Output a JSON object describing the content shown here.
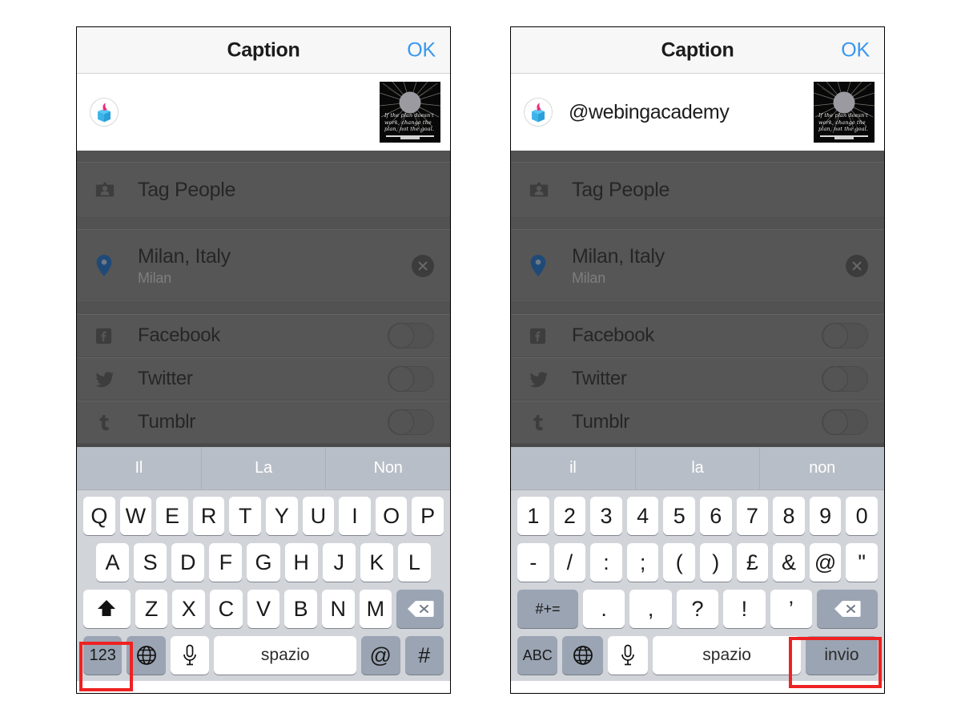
{
  "app": {
    "navbar": {
      "title": "Caption",
      "confirm_label": "OK"
    }
  },
  "left_panel": {
    "caption_value": "",
    "caption_placeholder": "",
    "avatar_icon": "book-avatar-icon",
    "thumbnail": {
      "icon": "post-thumbnail",
      "quote_line1": "If the plan doesn't",
      "quote_line2": "work, change the",
      "quote_line3": "plan, not the goal."
    },
    "options": [
      {
        "label": "Tag People",
        "icon": "tag-people-icon",
        "type": "nav"
      },
      {
        "label": "Milan, Italy",
        "sublabel": "Milan",
        "icon": "location-pin-icon",
        "type": "location",
        "clear_icon": "clear-circle-icon"
      },
      {
        "label": "Facebook",
        "icon": "facebook-icon",
        "type": "toggle",
        "state": "off"
      },
      {
        "label": "Twitter",
        "icon": "twitter-icon",
        "type": "toggle",
        "state": "off"
      },
      {
        "label": "Tumblr",
        "icon": "tumblr-icon",
        "type": "toggle",
        "state": "off"
      }
    ],
    "keyboard": {
      "layout": "letters",
      "suggestions": [
        "Il",
        "La",
        "Non"
      ],
      "row1": [
        "Q",
        "W",
        "E",
        "R",
        "T",
        "Y",
        "U",
        "I",
        "O",
        "P"
      ],
      "row2": [
        "A",
        "S",
        "D",
        "F",
        "G",
        "H",
        "J",
        "K",
        "L"
      ],
      "row3": [
        "Z",
        "X",
        "C",
        "V",
        "B",
        "N",
        "M"
      ],
      "shift_icon": "shift-up-arrow-icon",
      "delete_icon": "backspace-icon",
      "mode_key": "123",
      "globe_icon": "globe-icon",
      "mic_icon": "microphone-icon",
      "space_label": "spazio",
      "at_key": "@",
      "hash_key": "#"
    },
    "highlight": {
      "target": "123",
      "color": "#ee2222"
    }
  },
  "right_panel": {
    "caption_value": "@webingacademy",
    "avatar_icon": "book-avatar-icon",
    "thumbnail": {
      "icon": "post-thumbnail",
      "quote_line1": "If the plan doesn't",
      "quote_line2": "work, change the",
      "quote_line3": "plan, not the goal."
    },
    "options": [
      {
        "label": "Tag People",
        "icon": "tag-people-icon",
        "type": "nav"
      },
      {
        "label": "Milan, Italy",
        "sublabel": "Milan",
        "icon": "location-pin-icon",
        "type": "location",
        "clear_icon": "clear-circle-icon"
      },
      {
        "label": "Facebook",
        "icon": "facebook-icon",
        "type": "toggle",
        "state": "off"
      },
      {
        "label": "Twitter",
        "icon": "twitter-icon",
        "type": "toggle",
        "state": "off"
      },
      {
        "label": "Tumblr",
        "icon": "tumblr-icon",
        "type": "toggle",
        "state": "off"
      }
    ],
    "keyboard": {
      "layout": "numbers",
      "suggestions": [
        "il",
        "la",
        "non"
      ],
      "row1": [
        "1",
        "2",
        "3",
        "4",
        "5",
        "6",
        "7",
        "8",
        "9",
        "0"
      ],
      "row2": [
        "-",
        "/",
        ":",
        ";",
        "(",
        ")",
        "£",
        "&",
        "@",
        "\""
      ],
      "row3": [
        ".",
        ",",
        "?",
        "!",
        "’"
      ],
      "symbols_key": "#+=",
      "delete_icon": "backspace-icon",
      "mode_key": "ABC",
      "globe_icon": "globe-icon",
      "mic_icon": "microphone-icon",
      "space_label": "spazio",
      "return_key": "invio"
    },
    "highlight": {
      "target": "invio",
      "color": "#ee2222"
    }
  },
  "colors": {
    "accent_blue": "#3797f0",
    "highlight_red": "#ee2222",
    "dim_overlay": "#565656",
    "keyboard_bg": "#d1d4d9",
    "suggestion_bg": "#b8bec7",
    "dark_key": "#9aa4b3",
    "location_pin": "#1f4a78"
  }
}
